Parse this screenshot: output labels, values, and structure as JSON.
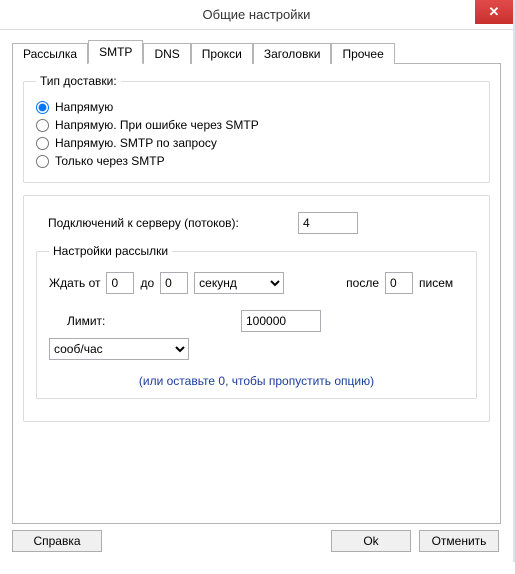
{
  "window": {
    "title": "Общие настройки",
    "close_glyph": "✕"
  },
  "tabs": {
    "t0": "Рассылка",
    "t1": "SMTP",
    "t2": "DNS",
    "t3": "Прокси",
    "t4": "Заголовки",
    "t5": "Прочее"
  },
  "delivery": {
    "legend": "Тип доставки:",
    "opt_direct": "Напрямую",
    "opt_direct_err": "Напрямую. При ошибке через SMTP",
    "opt_direct_req": "Напрямую. SMTP по запросу",
    "opt_smtp_only": "Только через SMTP"
  },
  "conn": {
    "label": "Подключений к серверу (потоков):",
    "value": "4"
  },
  "sending": {
    "legend": "Настройки рассылки",
    "wait_from_label": "Ждать от",
    "wait_from_value": "0",
    "wait_to_label": "до",
    "wait_to_value": "0",
    "unit_seconds": "секунд",
    "after_label": "после",
    "after_value": "0",
    "letters_label": "писем",
    "limit_label": "Лимит:",
    "limit_value": "100000",
    "limit_unit": "сооб/час",
    "hint": "(или оставьте 0, чтобы пропустить опцию)"
  },
  "buttons": {
    "help": "Справка",
    "ok": "Ok",
    "cancel": "Отменить"
  }
}
